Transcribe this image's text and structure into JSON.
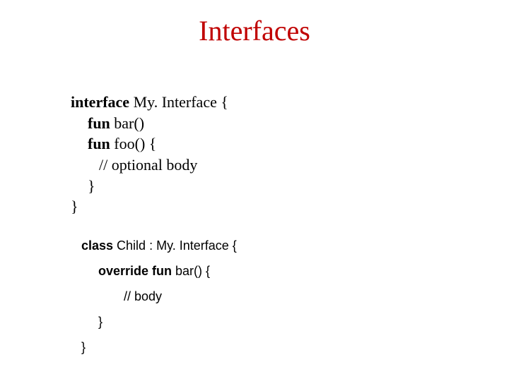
{
  "title": "Interfaces",
  "code1": {
    "l1_kw": "interface",
    "l1_rest": " My. Interface {",
    "l2_kw": "fun",
    "l2_rest": " bar()",
    "l3_kw": "fun",
    "l3_rest": " foo() {",
    "l4": "// optional body",
    "l5": "}",
    "l6": "}"
  },
  "code2": {
    "l1_kw": "class ",
    "l1_rest": "Child : My. Interface {",
    "l2_kw": "override fun ",
    "l2_rest": "bar() {",
    "l3": "// body",
    "l4": "}",
    "l5": "}"
  }
}
